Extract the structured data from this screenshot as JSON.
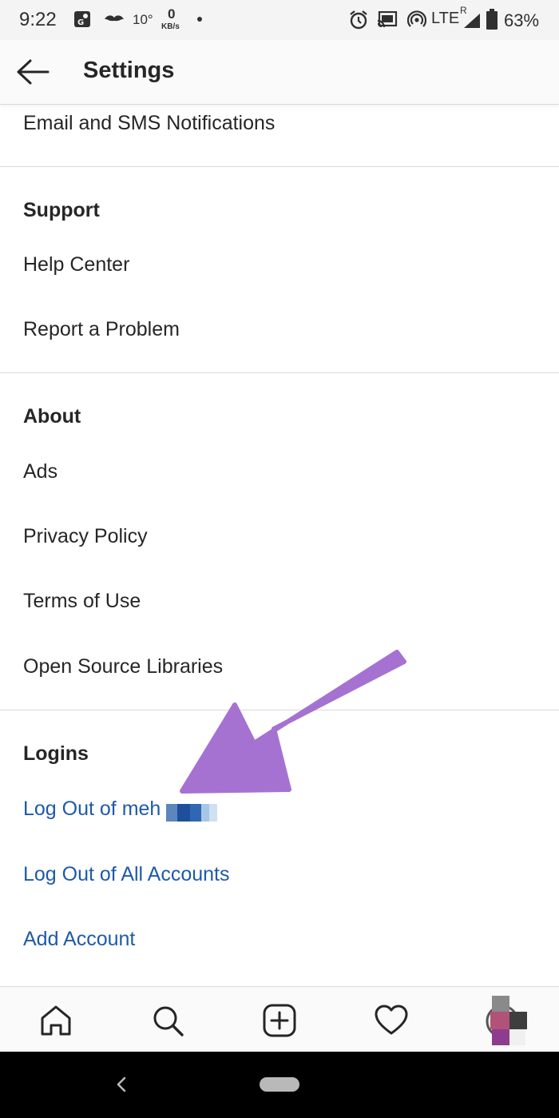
{
  "status_bar": {
    "time": "9:22",
    "temperature": "10°",
    "data_rate_value": "0",
    "data_rate_unit": "KB/s",
    "network": "LTE",
    "network_sup": "R",
    "battery": "63%"
  },
  "app_bar": {
    "title": "Settings"
  },
  "settings": {
    "email_sms": "Email and SMS Notifications",
    "support_header": "Support",
    "help_center": "Help Center",
    "report_problem": "Report a Problem",
    "about_header": "About",
    "ads": "Ads",
    "privacy_policy": "Privacy Policy",
    "terms_of_use": "Terms of Use",
    "open_source": "Open Source Libraries",
    "logins_header": "Logins",
    "log_out_account": "Log Out of meh",
    "log_out_all": "Log Out of All Accounts",
    "add_account": "Add Account"
  },
  "colors": {
    "link": "#1e5aa8",
    "annotation_arrow": "#a572d2"
  },
  "icons": {
    "back": "arrow-left-icon",
    "home": "home-icon",
    "search": "search-icon",
    "new_post": "plus-square-icon",
    "activity": "heart-icon",
    "profile": "avatar"
  }
}
